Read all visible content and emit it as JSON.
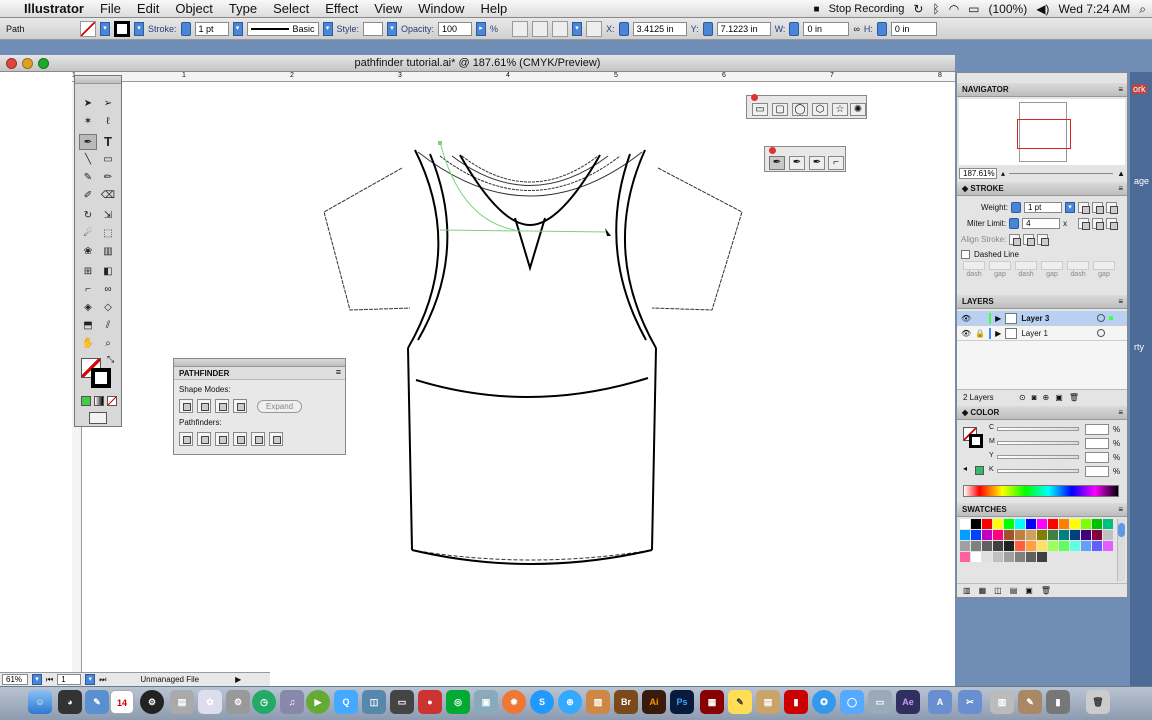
{
  "menubar": {
    "apple": "",
    "items": [
      "Illustrator",
      "File",
      "Edit",
      "Object",
      "Type",
      "Select",
      "Effect",
      "View",
      "Window",
      "Help"
    ],
    "recording": "Stop Recording",
    "battery": "(100%)",
    "clock": "Wed 7:24 AM"
  },
  "control": {
    "path_label": "Path",
    "stroke_label": "Stroke:",
    "stroke_value": "1 pt",
    "profile_value": "Basic",
    "style_label": "Style:",
    "opacity_label": "Opacity:",
    "opacity_value": "100",
    "pct": "%",
    "x_label": "X:",
    "x_value": "3.4125 in",
    "y_label": "Y:",
    "y_value": "7.1223 in",
    "w_label": "W:",
    "w_value": "0 in",
    "h_label": "H:",
    "h_value": "0 in"
  },
  "document": {
    "title": "pathfinder tutorial.ai* @ 187.61% (CMYK/Preview)",
    "ruler_marks": [
      "1",
      "1",
      "2",
      "3",
      "4",
      "5",
      "6",
      "7",
      "8"
    ],
    "zoom": "61%",
    "page": "1",
    "status": "Unmanaged File"
  },
  "pathfinder": {
    "title": "PATHFINDER",
    "shape_modes": "Shape Modes:",
    "expand": "Expand",
    "pathfinders": "Pathfinders:"
  },
  "navigator": {
    "title": "NAVIGATOR",
    "zoom": "187.61%"
  },
  "stroke_panel": {
    "title": "STROKE",
    "weight_label": "Weight:",
    "weight_value": "1 pt",
    "miter_label": "Miter Limit:",
    "miter_value": "4",
    "x": "x",
    "align_label": "Align Stroke:",
    "dashed": "Dashed Line",
    "dash_labels": [
      "dash",
      "gap",
      "dash",
      "gap",
      "dash",
      "gap"
    ]
  },
  "layers": {
    "title": "LAYERS",
    "rows": [
      {
        "name": "Layer 3",
        "selected": true
      },
      {
        "name": "Layer 1",
        "selected": false
      }
    ],
    "count": "2 Layers"
  },
  "color_panel": {
    "title": "COLOR",
    "channels": [
      "C",
      "M",
      "Y",
      "K"
    ],
    "pct": "%"
  },
  "swatches": {
    "title": "SWATCHES",
    "colors": [
      "#ffffff",
      "#000000",
      "#ff0000",
      "#ffff00",
      "#00ff00",
      "#00ffff",
      "#0000ff",
      "#ff00ff",
      "#ff0000",
      "#ff8000",
      "#ffff00",
      "#80ff00",
      "#00c000",
      "#00c080",
      "#00a0ff",
      "#0040ff",
      "#c000c0",
      "#ff0080",
      "#a0522d",
      "#c08040",
      "#d0a060",
      "#808000",
      "#408040",
      "#008080",
      "#004080",
      "#400080",
      "#800040",
      "#c0c0c0",
      "#a0a0a0",
      "#808080",
      "#606060",
      "#404040",
      "#202020",
      "#ff6040",
      "#ffa040",
      "#ffe060",
      "#a0ff60",
      "#60ff60",
      "#60ffe0",
      "#60a0ff",
      "#6060ff",
      "#e060ff",
      "#ff60a0",
      "#ffffff",
      "#e0e0e0",
      "#c0c0c0",
      "#a0a0a0",
      "#808080",
      "#606060",
      "#404040"
    ]
  },
  "edge": {
    "labels": [
      "ork",
      "age",
      "rty"
    ]
  },
  "dock": {
    "items": [
      "Finder",
      "iChat",
      "Calendar",
      "Photos",
      "Preview",
      "Safari",
      "Illustrator",
      "Photoshop",
      "Mail"
    ],
    "br": "Br",
    "ai": "Ai",
    "ps": "Ps",
    "ae": "Ae",
    "cal": "14"
  }
}
